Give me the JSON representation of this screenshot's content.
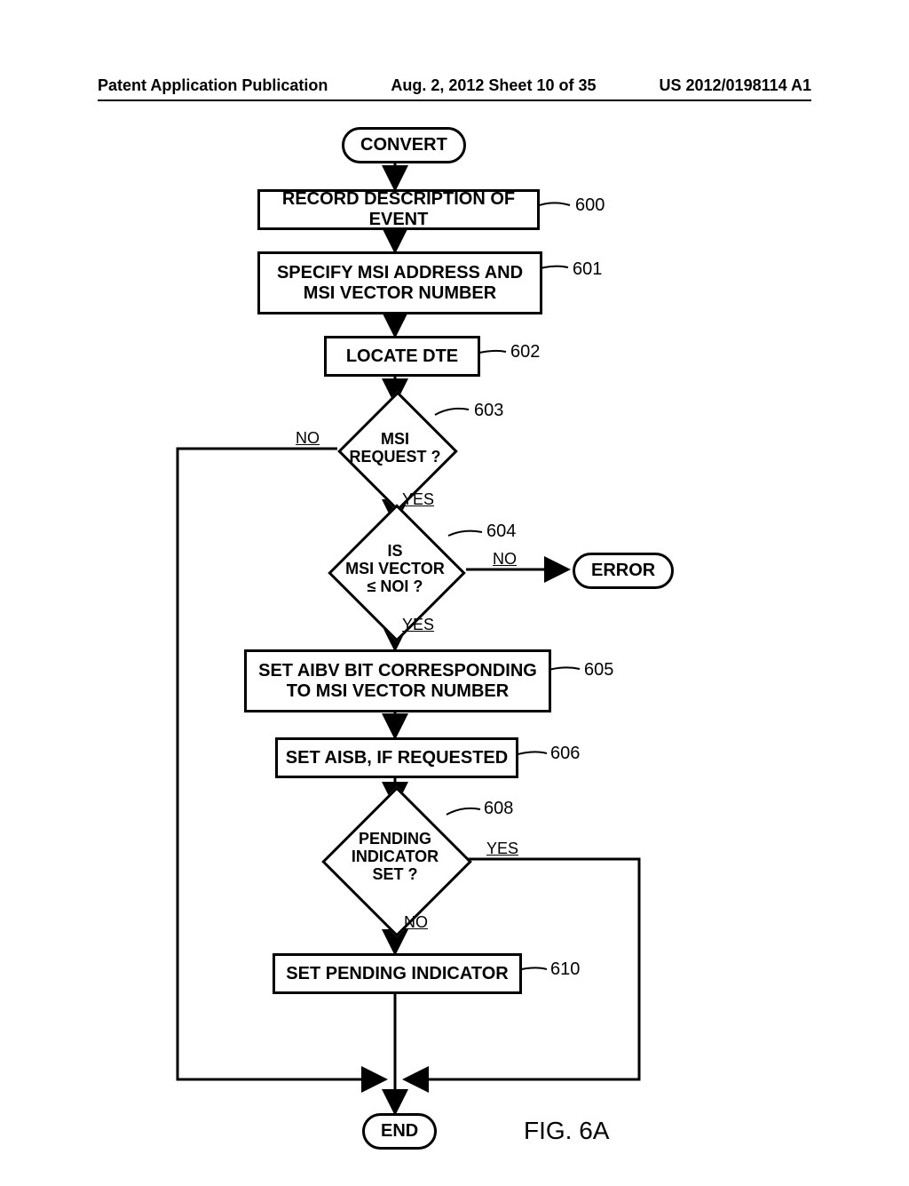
{
  "header": {
    "left": "Patent Application Publication",
    "center": "Aug. 2, 2012  Sheet 10 of 35",
    "right": "US 2012/0198114 A1"
  },
  "figure_label": "FIG. 6A",
  "nodes": {
    "start": "CONVERT",
    "n600": "RECORD DESCRIPTION OF EVENT",
    "n601": "SPECIFY MSI ADDRESS AND\nMSI VECTOR NUMBER",
    "n602": "LOCATE DTE",
    "n603": "MSI\nREQUEST ?",
    "n604": "IS\nMSI VECTOR\n≤ NOI ?",
    "error": "ERROR",
    "n605": "SET AIBV BIT CORRESPONDING\nTO MSI VECTOR NUMBER",
    "n606": "SET AISB, IF REQUESTED",
    "n608": "PENDING\nINDICATOR\nSET ?",
    "n610": "SET PENDING INDICATOR",
    "end": "END"
  },
  "refs": {
    "r600": "600",
    "r601": "601",
    "r602": "602",
    "r603": "603",
    "r604": "604",
    "r605": "605",
    "r606": "606",
    "r608": "608",
    "r610": "610"
  },
  "edges": {
    "no": "NO",
    "yes": "YES"
  },
  "chart_data": {
    "type": "flowchart",
    "title": "FIG. 6A",
    "nodes": [
      {
        "id": "start",
        "shape": "terminator",
        "label": "CONVERT"
      },
      {
        "id": "600",
        "shape": "process",
        "label": "RECORD DESCRIPTION OF EVENT"
      },
      {
        "id": "601",
        "shape": "process",
        "label": "SPECIFY MSI ADDRESS AND MSI VECTOR NUMBER"
      },
      {
        "id": "602",
        "shape": "process",
        "label": "LOCATE DTE"
      },
      {
        "id": "603",
        "shape": "decision",
        "label": "MSI REQUEST ?"
      },
      {
        "id": "604",
        "shape": "decision",
        "label": "IS MSI VECTOR ≤ NOI ?"
      },
      {
        "id": "error",
        "shape": "terminator",
        "label": "ERROR"
      },
      {
        "id": "605",
        "shape": "process",
        "label": "SET AIBV BIT CORRESPONDING TO MSI VECTOR NUMBER"
      },
      {
        "id": "606",
        "shape": "process",
        "label": "SET AISB, IF REQUESTED"
      },
      {
        "id": "608",
        "shape": "decision",
        "label": "PENDING INDICATOR SET ?"
      },
      {
        "id": "610",
        "shape": "process",
        "label": "SET PENDING INDICATOR"
      },
      {
        "id": "end",
        "shape": "terminator",
        "label": "END"
      }
    ],
    "edges": [
      {
        "from": "start",
        "to": "600"
      },
      {
        "from": "600",
        "to": "601"
      },
      {
        "from": "601",
        "to": "602"
      },
      {
        "from": "602",
        "to": "603"
      },
      {
        "from": "603",
        "to": "604",
        "label": "YES"
      },
      {
        "from": "603",
        "to": "end",
        "label": "NO"
      },
      {
        "from": "604",
        "to": "605",
        "label": "YES"
      },
      {
        "from": "604",
        "to": "error",
        "label": "NO"
      },
      {
        "from": "605",
        "to": "606"
      },
      {
        "from": "606",
        "to": "608"
      },
      {
        "from": "608",
        "to": "610",
        "label": "NO"
      },
      {
        "from": "608",
        "to": "end",
        "label": "YES"
      },
      {
        "from": "610",
        "to": "end"
      }
    ]
  }
}
